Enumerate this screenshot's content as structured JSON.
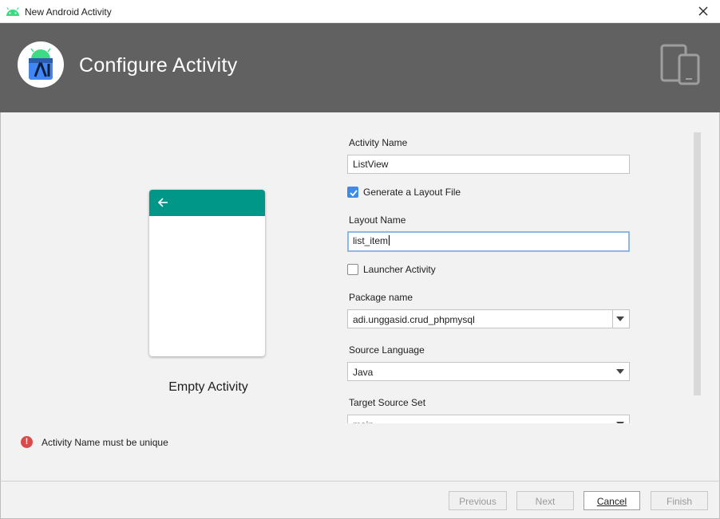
{
  "window": {
    "title": "New Android Activity"
  },
  "header": {
    "title": "Configure Activity"
  },
  "preview": {
    "template_label": "Empty Activity",
    "appbar_color": "#009688"
  },
  "form": {
    "activity_name": {
      "label": "Activity Name",
      "value": "ListView"
    },
    "generate_layout": {
      "label": "Generate a Layout File",
      "checked": true
    },
    "layout_name": {
      "label": "Layout Name",
      "value": "list_item"
    },
    "launcher_activity": {
      "label": "Launcher Activity",
      "checked": false
    },
    "package_name": {
      "label": "Package name",
      "value": "adi.unggasid.crud_phpmysql"
    },
    "source_language": {
      "label": "Source Language",
      "value": "Java"
    },
    "target_source_set": {
      "label": "Target Source Set",
      "value": "main"
    }
  },
  "error": {
    "message": "Activity Name must be unique",
    "color": "#d94b4b"
  },
  "footer": {
    "previous": "Previous",
    "next": "Next",
    "cancel": "Cancel",
    "finish": "Finish"
  },
  "colors": {
    "header_bg": "#616161",
    "accent": "#3c8ce7"
  }
}
